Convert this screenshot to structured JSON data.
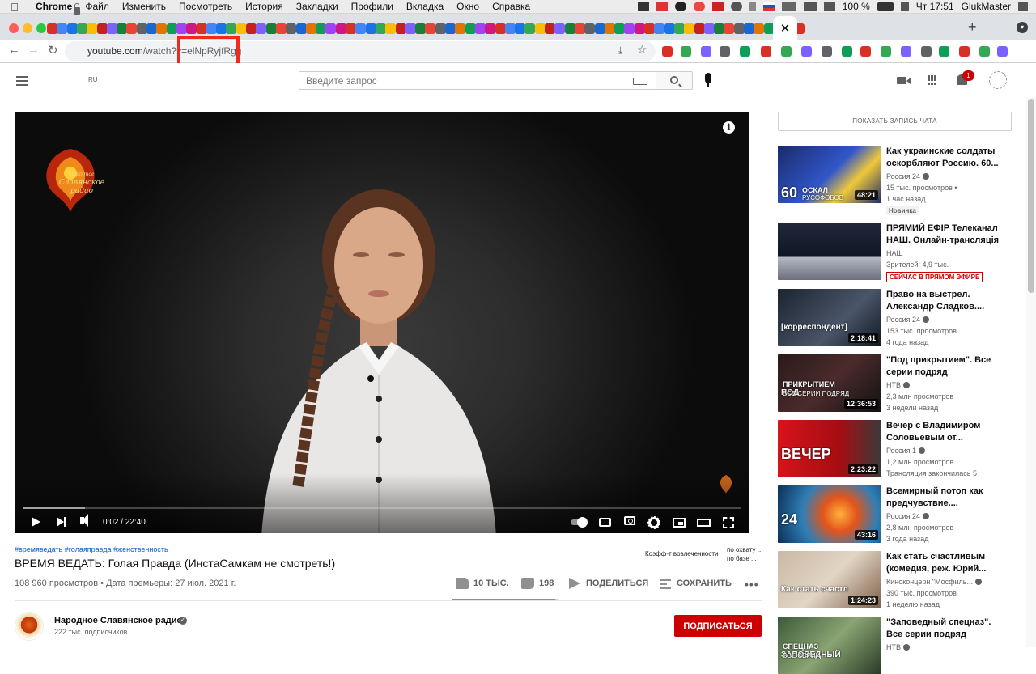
{
  "menubar": {
    "app": "Chrome",
    "items": [
      "Файл",
      "Изменить",
      "Посмотреть",
      "История",
      "Закладки",
      "Профили",
      "Вкладка",
      "Окно",
      "Справка"
    ],
    "battery": "100 %",
    "clock": "Чт 17:51",
    "user": "GlukMaster"
  },
  "browser": {
    "url_host": "youtube.com",
    "url_path": "/watch?v=elNpRyjfRgg"
  },
  "masthead": {
    "country": "RU",
    "search_placeholder": "Введите запрос",
    "notification_count": "1"
  },
  "player": {
    "logo_text_1": "Народное",
    "logo_text_2": "Славянское",
    "logo_text_3": "радио",
    "current_time": "0:02",
    "duration": "22:40",
    "time_separator": " / ",
    "progress_fraction": 0.0015
  },
  "video": {
    "hashtags": "#времяведать #голаяправда #женственность",
    "title": "ВРЕМЯ ВЕДАТЬ: Голая Правда (ИнстаСамкам не смотреть!)",
    "views": "108 960 просмотров",
    "premiere": "Дата премьеры: 27 июл. 2021 г.",
    "view_separator": " • ",
    "engagement_label": "Коэфф-т вовлеченности",
    "reach_label_1": "по охвату ...",
    "reach_label_2": "по базе ...",
    "likes": "10 ТЫС.",
    "dislikes": "198",
    "share_label": "ПОДЕЛИТЬСЯ",
    "save_label": "СОХРАНИТЬ",
    "like_ratio": 0.98
  },
  "channel": {
    "name": "Народное Славянское радио",
    "subscribers": "222 тыс. подписчиков",
    "subscribe_label": "ПОДПИСАТЬСЯ"
  },
  "sidebar": {
    "chat_label": "ПОКАЗАТЬ ЗАПИСЬ ЧАТА",
    "items": [
      {
        "title": "Как украинские солдаты оскорбляют Россию. 60...",
        "channel": "Россия 24",
        "verified": true,
        "meta1": "15 тыс. просмотров •",
        "meta2": "1 час назад",
        "badge": "Новинка",
        "duration": "48:21",
        "thumb_text_1": "60",
        "thumb_text_2": "ОСКАЛ",
        "thumb_text_3": "РУСОФОБОВ"
      },
      {
        "title": "ПРЯМИЙ ЕФІР Телеканал НАШ. Онлайн-трансляція",
        "channel": "НАШ",
        "verified": false,
        "meta1": "Зрителей: 4,9 тыс.",
        "meta2": "",
        "live": "СЕЙЧАС В ПРЯМОМ ЭФИРЕ",
        "duration": ""
      },
      {
        "title": "Право на выстрел. Александр Сладков....",
        "channel": "Россия 24",
        "verified": true,
        "meta1": "153 тыс. просмотров",
        "meta2": "4 года назад",
        "duration": "2:18:41",
        "thumb_text_1": "[корреспондент]"
      },
      {
        "title": "\"Под прикрытием\". Все серии подряд",
        "channel": "НТВ",
        "verified": true,
        "meta1": "2,3 млн просмотров",
        "meta2": "3 недели назад",
        "duration": "12:36:53",
        "thumb_text_1": "ПОД",
        "thumb_text_2": "ПРИКРЫТИЕМ",
        "thumb_text_3": "ВСЕ СЕРИИ ПОДРЯД"
      },
      {
        "title": "Вечер с Владимиром Соловьевым от...",
        "channel": "Россия 1",
        "verified": true,
        "meta1": "1,2 млн просмотров",
        "meta2": "Трансляция закончилась 5",
        "duration": "2:23:22",
        "thumb_text_1": "ВЕЧЕР"
      },
      {
        "title": "Всемирный потоп как предчувствие....",
        "channel": "Россия 24",
        "verified": true,
        "meta1": "2,8 млн просмотров",
        "meta2": "3 года назад",
        "duration": "43:16",
        "thumb_text_1": "24"
      },
      {
        "title": "Как стать счастливым (комедия, реж. Юрий...",
        "channel": "Киноконцерн \"Мосфиль...",
        "verified": true,
        "meta1": "390 тыс. просмотров",
        "meta2": "1 неделю назад",
        "duration": "1:24:23",
        "thumb_text_1": "Как стать счастл"
      },
      {
        "title": "\"Заповедный спецназ\". Все серии подряд",
        "channel": "НТВ",
        "verified": true,
        "meta1": "",
        "meta2": "",
        "duration": "",
        "thumb_text_1": "ЗАПОВЕДНЫЙ",
        "thumb_text_2": "СПЕЦНАЗ",
        "thumb_text_3": "ВСЕ СЕРИИ"
      }
    ]
  },
  "colors": {
    "brand_red": "#cc0000",
    "link_blue": "#065fd4",
    "highlight_red": "#ef2a1f"
  }
}
